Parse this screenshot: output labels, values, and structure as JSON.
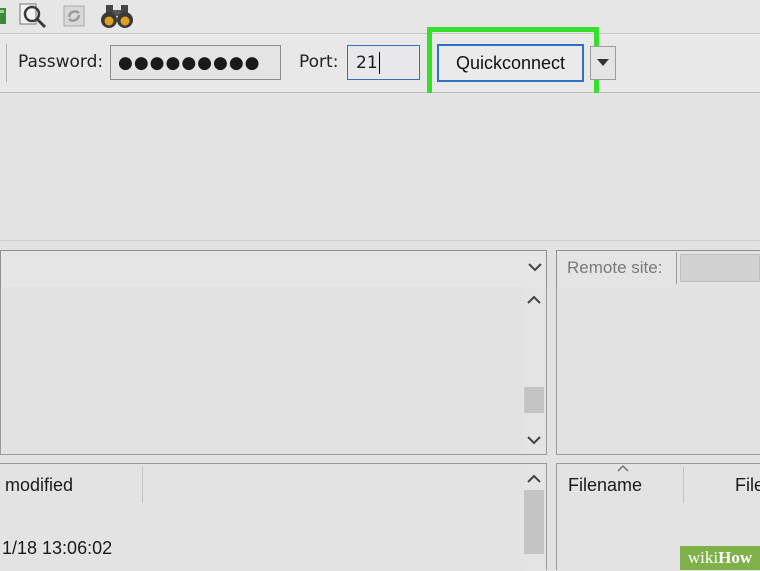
{
  "quickconnect": {
    "password_label": "Password:",
    "password_value": "●●●●●●●●●",
    "port_label": "Port:",
    "port_value": "21",
    "button_label": "Quickconnect"
  },
  "toolbar": {
    "icons": [
      "site-manager-icon",
      "search-remote-icon",
      "refresh-icon",
      "binoculars-icon"
    ]
  },
  "remote": {
    "site_label": "Remote site:"
  },
  "local_list": {
    "column_modified": "modified",
    "row_date": "1/18 13:06:02"
  },
  "remote_list": {
    "column_filename": "Filename",
    "column_filetype": "File"
  },
  "watermark": {
    "wiki": "wiki",
    "how": "How"
  },
  "colors": {
    "highlight": "#35e02a",
    "focus_border": "#2f6fc4",
    "watermark_bg": "#7fb04a"
  }
}
